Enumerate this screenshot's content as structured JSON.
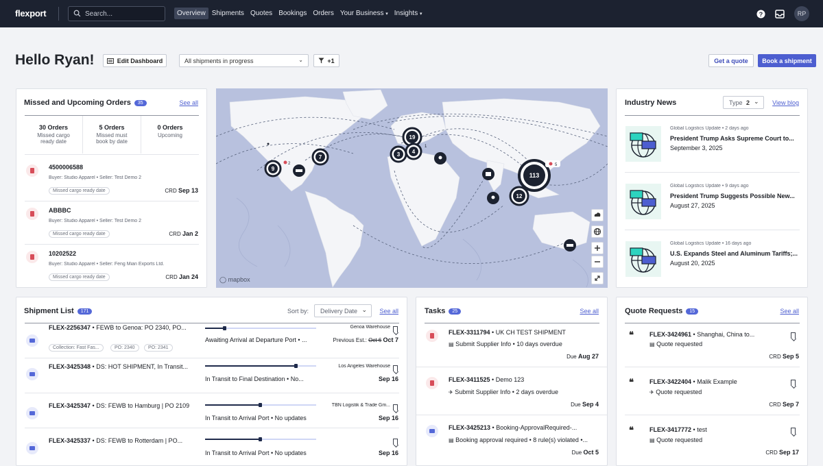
{
  "nav": {
    "logo": "flexport",
    "search_placeholder": "Search...",
    "items": [
      "Overview",
      "Shipments",
      "Quotes",
      "Bookings",
      "Orders",
      "Your Business",
      "Insights"
    ],
    "active": "Overview",
    "avatar": "RP"
  },
  "header": {
    "greeting": "Hello Ryan!",
    "edit_dashboard": "Edit Dashboard",
    "filter_select": "All shipments in progress",
    "filter_count": "+1",
    "get_quote": "Get a quote",
    "book_shipment": "Book a shipment"
  },
  "orders": {
    "title": "Missed and Upcoming Orders",
    "badge": "35",
    "see_all": "See all",
    "stats": [
      {
        "count": "30 Orders",
        "label1": "Missed cargo",
        "label2": "ready date"
      },
      {
        "count": "5 Orders",
        "label1": "Missed must",
        "label2": "book by date"
      },
      {
        "count": "0 Orders",
        "label1": "Upcoming",
        "label2": ""
      }
    ],
    "items": [
      {
        "id": "4500006588",
        "sub": "Buyer: Studio Apparel • Seller: Test Demo 2",
        "pill": "Missed cargo ready date",
        "crd_label": "CRD",
        "crd": "Sep 13"
      },
      {
        "id": "ABBBC",
        "sub": "Buyer: Studio Apparel • Seller: Test Demo 2",
        "pill": "Missed cargo ready date",
        "crd_label": "CRD",
        "crd": "Jan 2"
      },
      {
        "id": "10202522",
        "sub": "Buyer: Studio Apparel • Seller: Feng Mian Exports Ltd.",
        "pill": "Missed cargo ready date",
        "crd_label": "CRD",
        "crd": "Jan 24"
      }
    ]
  },
  "map": {
    "attribution": "mapbox",
    "clusters": [
      "19",
      "3",
      "4",
      "1",
      "7",
      "9",
      "2",
      "113",
      "5",
      "12"
    ]
  },
  "news": {
    "title": "Industry News",
    "type_label": "Type",
    "type_count": "2",
    "view_blog": "View blog",
    "items": [
      {
        "meta": "Global Logistics Update • 2 days ago",
        "headline": "President Trump Asks Supreme Court to...",
        "date": "September 3, 2025"
      },
      {
        "meta": "Global Logistics Update • 9 days ago",
        "headline": "President Trump Suggests Possible New...",
        "date": "August 27, 2025"
      },
      {
        "meta": "Global Logistics Update • 16 days ago",
        "headline": "U.S. Expands Steel and Aluminum Tariffs;...",
        "date": "August 20, 2025"
      }
    ]
  },
  "shipments": {
    "title": "Shipment List",
    "badge": "171",
    "sort_label": "Sort by:",
    "sort_value": "Delivery Date",
    "see_all": "See all",
    "items": [
      {
        "id": "FLEX-2256347",
        "desc": " • FEWB to Genoa: PO 2340, PO...",
        "tags": [
          "Collection: Fast Fas...",
          "PO: 2340",
          "PO: 2341"
        ],
        "progress": 0.18,
        "status": "Awaiting Arrival at Departure Port • ...",
        "location": "Genoa Warehouse",
        "prev": "Previous Est.:",
        "old": "Oct 6",
        "date": "Oct 7"
      },
      {
        "id": "FLEX-3425348",
        "desc": " • DS: HOT SHIPMENT, In Transit...",
        "tags": [],
        "progress": 0.82,
        "status": "In Transit to Final Destination • No...",
        "location": "Los Angeles Warehouse",
        "prev": "",
        "old": "",
        "date": "Sep 16"
      },
      {
        "id": "FLEX-3425347",
        "desc": " • DS: FEWB to Hamburg | PO 2109",
        "tags": [],
        "progress": 0.5,
        "status": "In Transit to Arrival Port • No updates",
        "location": "TBN Logistik & Trade Gm...",
        "prev": "",
        "old": "",
        "date": "Sep 16"
      },
      {
        "id": "FLEX-3425337",
        "desc": " • DS: FEWB to Rotterdam | PO...",
        "tags": [],
        "progress": 0.5,
        "status": "In Transit to Arrival Port • No updates",
        "location": "",
        "prev": "",
        "old": "",
        "date": "Sep 16"
      }
    ]
  },
  "tasks": {
    "title": "Tasks",
    "badge": "25",
    "see_all": "See all",
    "items": [
      {
        "id": "FLEX-3311794",
        "desc": " • UK CH TEST SHIPMENT",
        "sub": "Submit Supplier Info • 10 days overdue",
        "due_label": "Due",
        "due": "Aug 27"
      },
      {
        "id": "FLEX-3411525",
        "desc": " • Demo 123",
        "sub": "Submit Supplier Info • 2 days overdue",
        "due_label": "Due",
        "due": "Sep 4"
      },
      {
        "id": "FLEX-3425213",
        "desc": " • Booking-ApprovalRequired-...",
        "sub": "Booking approval required • 8 rule(s) violated •...",
        "due_label": "Due",
        "due": "Oct 5"
      }
    ]
  },
  "quotes": {
    "title": "Quote Requests",
    "badge": "15",
    "see_all": "See all",
    "items": [
      {
        "id": "FLEX-3424961",
        "desc": " • Shanghai, China to...",
        "sub": "Quote requested",
        "crd_label": "CRD",
        "crd": "Sep 5"
      },
      {
        "id": "FLEX-3422404",
        "desc": " • Malik Example",
        "sub": "Quote requested",
        "crd_label": "CRD",
        "crd": "Sep 7"
      },
      {
        "id": "FLEX-3417772",
        "desc": " • test",
        "sub": "Quote requested",
        "crd_label": "CRD",
        "crd": "Sep 17"
      }
    ]
  }
}
